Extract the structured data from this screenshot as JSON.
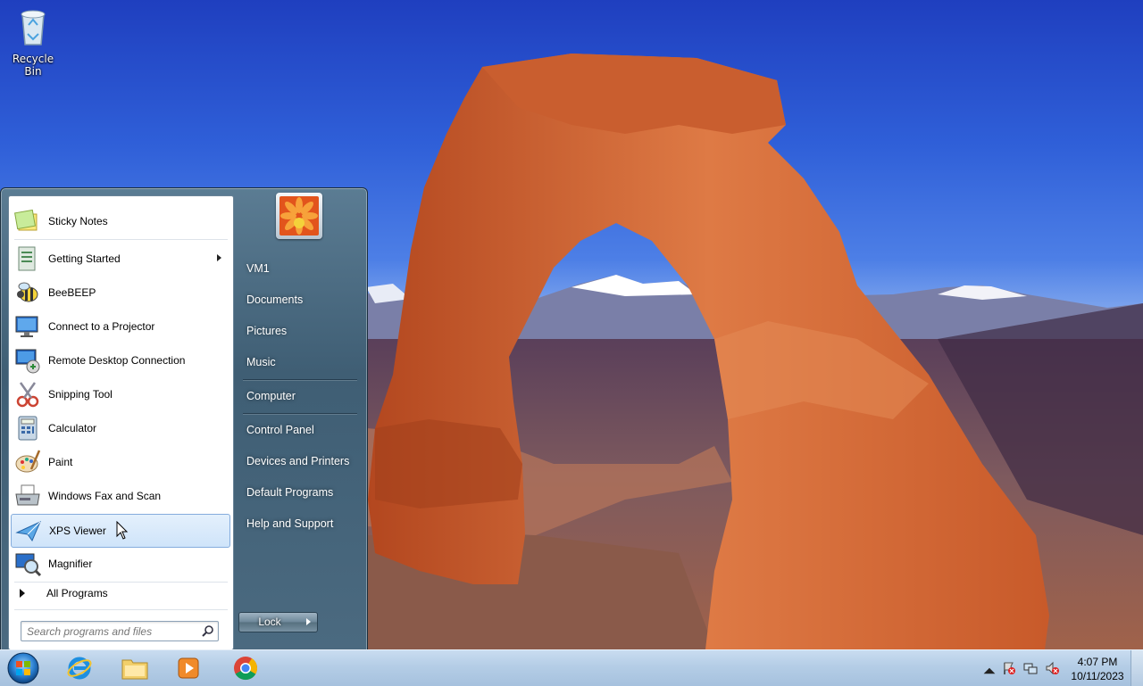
{
  "desktop": {
    "icons": [
      {
        "label": "Recycle Bin",
        "icon": "recycle-bin-icon"
      }
    ]
  },
  "start_menu": {
    "programs": [
      {
        "label": "Sticky Notes",
        "icon": "sticky-notes-icon"
      },
      {
        "label": "Getting Started",
        "icon": "getting-started-icon",
        "has_submenu": true
      },
      {
        "label": "BeeBEEP",
        "icon": "bee-icon"
      },
      {
        "label": "Connect to a Projector",
        "icon": "projector-icon"
      },
      {
        "label": "Remote Desktop Connection",
        "icon": "remote-desktop-icon"
      },
      {
        "label": "Snipping Tool",
        "icon": "scissors-icon"
      },
      {
        "label": "Calculator",
        "icon": "calculator-icon"
      },
      {
        "label": "Paint",
        "icon": "paint-palette-icon"
      },
      {
        "label": "Windows Fax and Scan",
        "icon": "fax-icon"
      },
      {
        "label": "XPS Viewer",
        "icon": "xps-viewer-icon",
        "selected": true
      },
      {
        "label": "Magnifier",
        "icon": "magnifier-icon"
      }
    ],
    "all_programs": "All Programs",
    "search": {
      "placeholder": "Search programs and files",
      "value": ""
    },
    "right_links": {
      "user": "VM1",
      "documents": "Documents",
      "pictures": "Pictures",
      "music": "Music",
      "computer": "Computer",
      "control_panel": "Control Panel",
      "devices": "Devices and Printers",
      "default_programs": "Default Programs",
      "help": "Help and Support"
    },
    "power_button": "Lock"
  },
  "taskbar": {
    "pinned": [
      {
        "name": "Internet Explorer",
        "icon": "internet-explorer-icon"
      },
      {
        "name": "Windows Explorer",
        "icon": "folder-icon"
      },
      {
        "name": "Windows Media Player",
        "icon": "media-player-icon"
      },
      {
        "name": "Google Chrome",
        "icon": "chrome-icon"
      }
    ],
    "tray": {
      "time": "4:07 PM",
      "date": "10/11/2023"
    }
  },
  "colors": {
    "selection_border": "#84acdd",
    "taskbar": "#b4cde6",
    "start_menu_right": "#4b6a80"
  }
}
